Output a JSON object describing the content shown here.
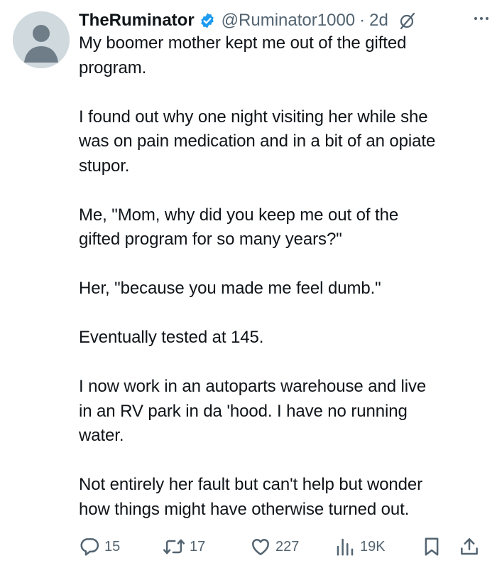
{
  "author": {
    "display_name": "TheRuminator",
    "handle": "@Ruminator1000",
    "separator": "·",
    "time": "2d"
  },
  "tweet": {
    "paragraphs": [
      [
        "My boomer mother kept me out of the gifted",
        "program."
      ],
      [
        "I found out why one night visiting her while she",
        "was on pain medication and in a bit of an opiate",
        "stupor."
      ],
      [
        "Me, \"Mom, why did you keep me out of the",
        "gifted program for so many years?\""
      ],
      [
        "Her, \"because you made me feel dumb.\""
      ],
      [
        "Eventually tested at 145."
      ],
      [
        "I now work in an autoparts warehouse and live",
        "in an RV park in da 'hood. I have no running",
        "water."
      ],
      [
        "Not entirely her fault but can't help but wonder",
        "how things might have otherwise turned out."
      ]
    ]
  },
  "metrics": {
    "replies": "15",
    "reposts": "17",
    "likes": "227",
    "views": "19K"
  },
  "icons": {
    "verified": "verified-badge-icon",
    "grok": "grok-icon",
    "more": "more-icon",
    "reply": "reply-icon",
    "repost": "repost-icon",
    "like": "heart-icon",
    "views": "views-icon",
    "bookmark": "bookmark-icon",
    "share": "share-icon"
  },
  "colors": {
    "text": "#0f1419",
    "secondary": "#536471",
    "verified": "#1d9bf0",
    "avatar": "#cfd9de"
  }
}
